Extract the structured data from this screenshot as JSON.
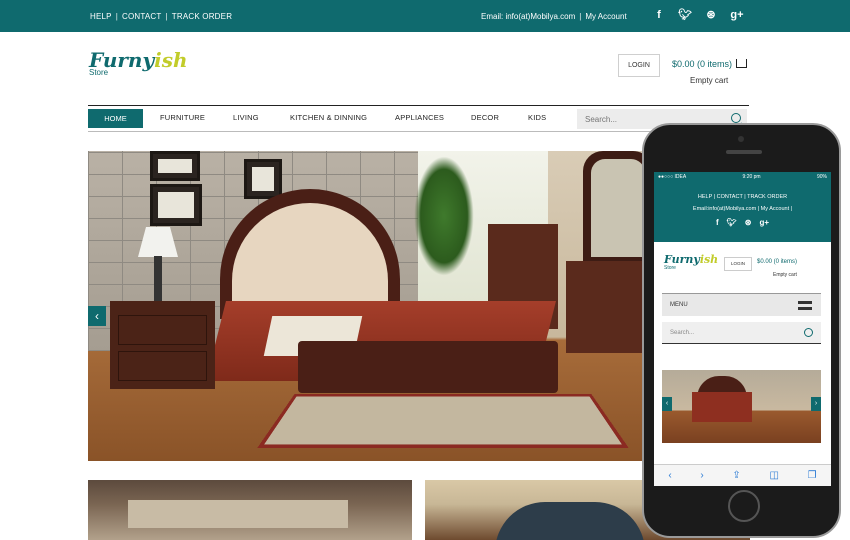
{
  "topbar": {
    "links": [
      "HELP",
      "CONTACT",
      "TRACK ORDER"
    ],
    "email": "Email: info(at)Mobilya.com",
    "account": "My Account",
    "social": [
      "f",
      "t",
      "d",
      "g+"
    ]
  },
  "header": {
    "logo_main_1": "Furny",
    "logo_main_2": "ish",
    "logo_sub": "Store",
    "login": "LOGIN",
    "cart_total": "$0.00 (0 items)",
    "cart_status": "Empty cart"
  },
  "nav": {
    "home": "HOME",
    "items": [
      "FURNITURE",
      "LIVING",
      "KITCHEN & DINNING",
      "APPLIANCES",
      "DECOR",
      "KIDS"
    ],
    "search_placeholder": "Search..."
  },
  "hero": {
    "prev_arrow": "‹"
  },
  "mobile": {
    "status_left": "●●○○○ IDEA",
    "status_time": "9:20 pm",
    "status_right": "90%",
    "links": "HELP | CONTACT | TRACK ORDER",
    "email_row": "Email:info(at)Mobilya.com | My Account |",
    "social": [
      "f",
      "t",
      "d",
      "g+"
    ],
    "logo_main_1": "Furny",
    "logo_main_2": "ish",
    "logo_sub": "Store",
    "login": "LOGIN",
    "cart_total": "$0.00 (0 items)",
    "cart_status": "Empty cart",
    "menu": "MENU",
    "search_placeholder": "Search...",
    "toolbar": [
      "‹",
      "›",
      "⇪",
      "◫",
      "❐"
    ]
  }
}
